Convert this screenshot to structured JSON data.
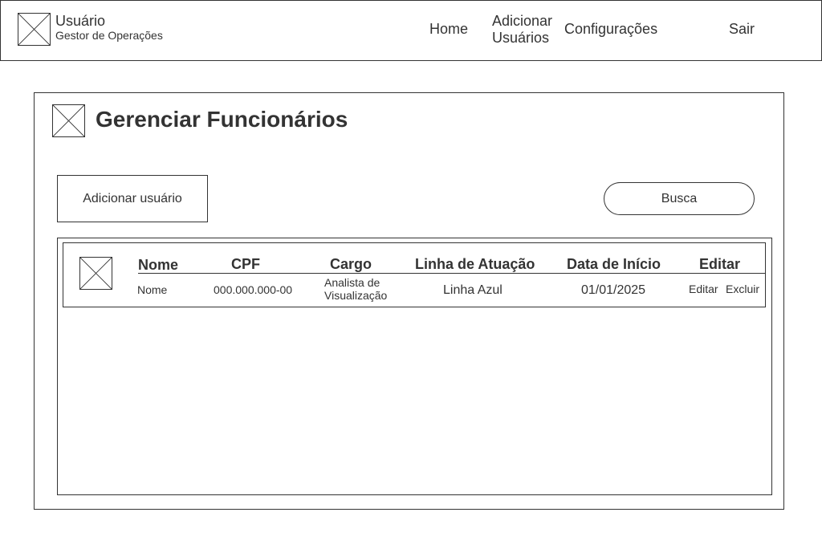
{
  "header": {
    "user_name": "Usuário",
    "user_role": "Gestor de Operações",
    "nav": {
      "home": "Home",
      "add_users_line1": "Adicionar",
      "add_users_line2": "Usuários",
      "settings": "Configurações",
      "logout": "Sair"
    }
  },
  "main": {
    "title": "Gerenciar Funcionários",
    "add_button": "Adicionar usuário",
    "search": "Busca",
    "table": {
      "columns": [
        "Nome",
        "CPF",
        "Cargo",
        "Linha de Atuação",
        "Data de Início",
        "Editar"
      ],
      "rows": [
        {
          "nome": "Nome",
          "cpf": "000.000.000-00",
          "cargo": "Analista de Visualização",
          "linha": "Linha Azul",
          "data_inicio": "01/01/2025",
          "edit_label": "Editar",
          "delete_label": "Excluir"
        }
      ]
    }
  },
  "icons": {
    "avatar": "image-placeholder-icon",
    "page_icon": "image-placeholder-icon",
    "row_photo": "image-placeholder-icon"
  },
  "colors": {
    "stroke": "#333333",
    "background": "#ffffff"
  }
}
